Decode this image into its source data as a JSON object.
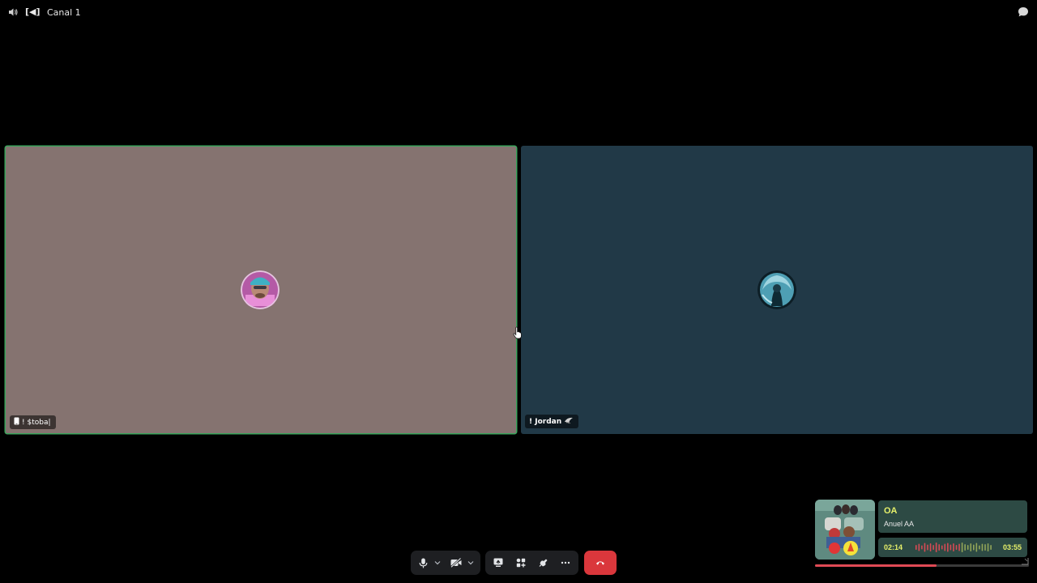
{
  "topbar": {
    "speaker_icon": "speaker-icon",
    "channel_prefix": "[◀]",
    "channel_name": "Canal 1",
    "chat_icon": "chat-bubble-icon"
  },
  "participants": [
    {
      "name": "! $toba|",
      "device_icon": "mobile-phone-icon",
      "speaking": true,
      "tile_color": "#857370",
      "border_color": "#3ba55d"
    },
    {
      "name": "! Jordan",
      "badge_icon": "wing-badge-icon",
      "speaking": false,
      "tile_color": "#213947"
    }
  ],
  "controls": {
    "mute_icon": "microphone-icon",
    "camera_icon": "camera-off-icon",
    "screenshare_icon": "screen-share-icon",
    "activities_icon": "activities-icon",
    "soundboard_icon": "soundboard-icon",
    "more_icon": "more-icon",
    "disconnect_icon": "hang-up-icon",
    "disconnect_color": "#da373c"
  },
  "music": {
    "title": "OA",
    "artist": "Anuel AA",
    "elapsed": "02:14",
    "duration": "03:55",
    "progress": 0.57,
    "accent_color": "#e6f06a",
    "progress_color": "#e04a55"
  }
}
